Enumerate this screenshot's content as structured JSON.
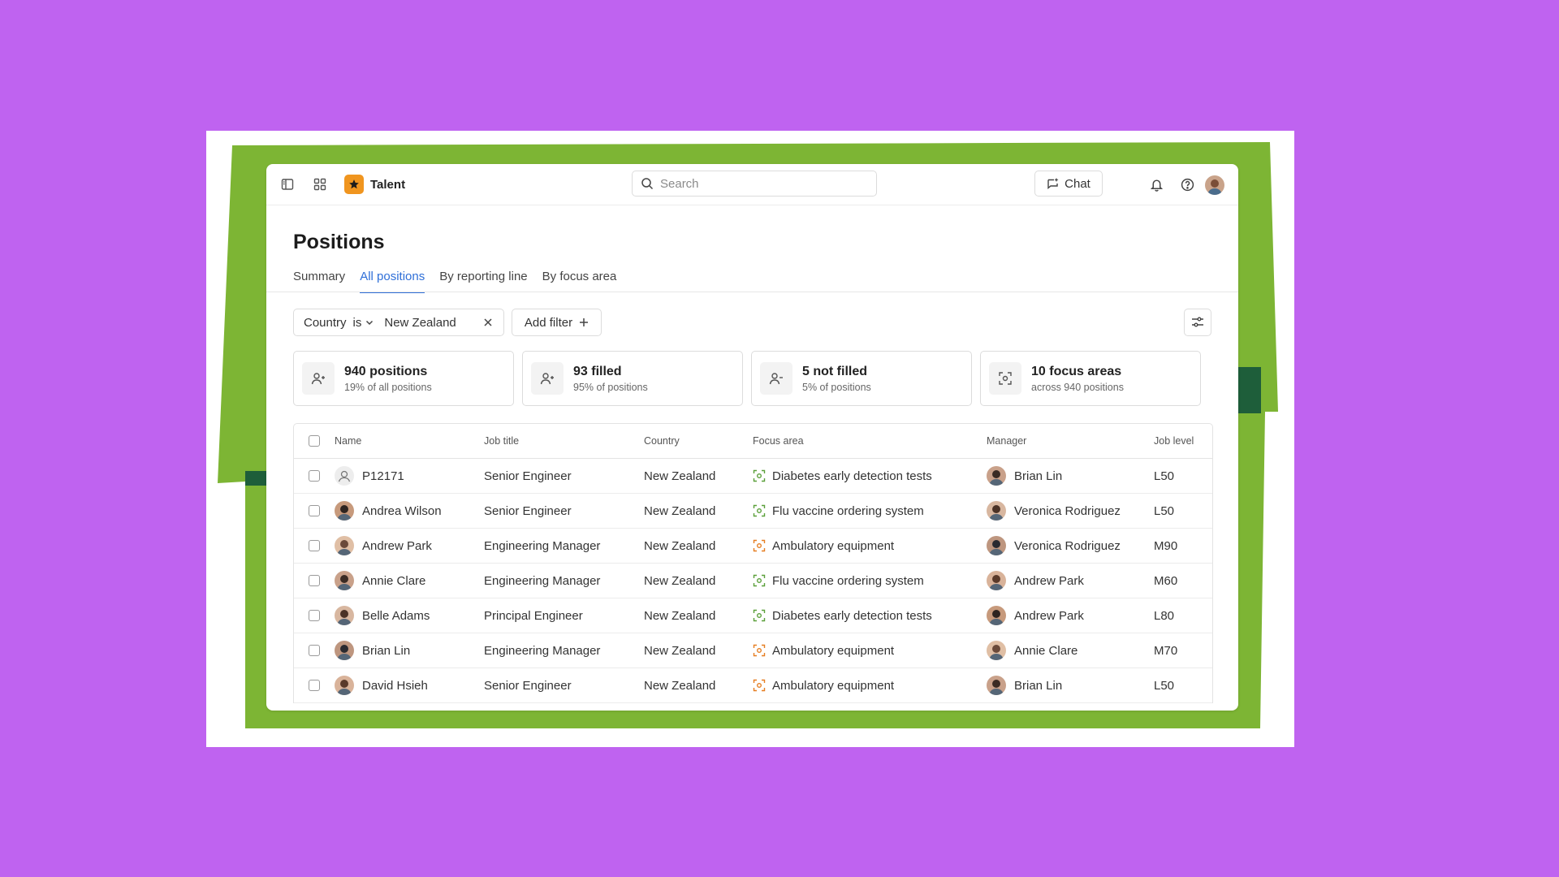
{
  "app": {
    "name": "Talent"
  },
  "header": {
    "search_placeholder": "Search",
    "chat_label": "Chat"
  },
  "page": {
    "title": "Positions"
  },
  "tabs": [
    {
      "label": "Summary",
      "active": false
    },
    {
      "label": "All positions",
      "active": true
    },
    {
      "label": "By reporting line",
      "active": false
    },
    {
      "label": "By focus area",
      "active": false
    }
  ],
  "filter": {
    "field": "Country",
    "operator": "is",
    "value": "New Zealand",
    "add_label": "Add filter"
  },
  "stats": [
    {
      "value": "940 positions",
      "sub": "19% of all positions",
      "icon": "person-icon"
    },
    {
      "value": "93 filled",
      "sub": "95% of positions",
      "icon": "person-add-icon"
    },
    {
      "value": "5 not filled",
      "sub": "5% of positions",
      "icon": "person-remove-icon"
    },
    {
      "value": "10 focus areas",
      "sub": "across 940 positions",
      "icon": "focus-icon"
    }
  ],
  "table": {
    "columns": [
      "Name",
      "Job title",
      "Country",
      "Focus area",
      "Manager",
      "Job level"
    ],
    "rows": [
      {
        "name": "P12171",
        "job": "Senior Engineer",
        "country": "New Zealand",
        "focus": "Diabetes early detection tests",
        "focus_color": "#5BA03A",
        "manager": "Brian Lin",
        "level": "L50",
        "avatar": "placeholder"
      },
      {
        "name": "Andrea Wilson",
        "job": "Senior Engineer",
        "country": "New Zealand",
        "focus": "Flu vaccine ordering system",
        "focus_color": "#5BA03A",
        "manager": "Veronica Rodriguez",
        "level": "L50"
      },
      {
        "name": "Andrew Park",
        "job": "Engineering Manager",
        "country": "New Zealand",
        "focus": "Ambulatory equipment",
        "focus_color": "#E67E22",
        "manager": "Veronica Rodriguez",
        "level": "M90"
      },
      {
        "name": "Annie Clare",
        "job": "Engineering Manager",
        "country": "New Zealand",
        "focus": "Flu vaccine ordering system",
        "focus_color": "#5BA03A",
        "manager": "Andrew Park",
        "level": "M60"
      },
      {
        "name": "Belle Adams",
        "job": "Principal Engineer",
        "country": "New Zealand",
        "focus": "Diabetes early detection tests",
        "focus_color": "#5BA03A",
        "manager": "Andrew Park",
        "level": "L80"
      },
      {
        "name": "Brian Lin",
        "job": "Engineering Manager",
        "country": "New Zealand",
        "focus": "Ambulatory equipment",
        "focus_color": "#E67E22",
        "manager": "Annie Clare",
        "level": "M70"
      },
      {
        "name": "David Hsieh",
        "job": "Senior Engineer",
        "country": "New Zealand",
        "focus": "Ambulatory equipment",
        "focus_color": "#E67E22",
        "manager": "Brian Lin",
        "level": "L50"
      }
    ]
  },
  "colors": {
    "accent": "#2F6FD8",
    "brand": "#F0951F",
    "background": "#BF63F0",
    "frame_green": "#7DB534"
  }
}
